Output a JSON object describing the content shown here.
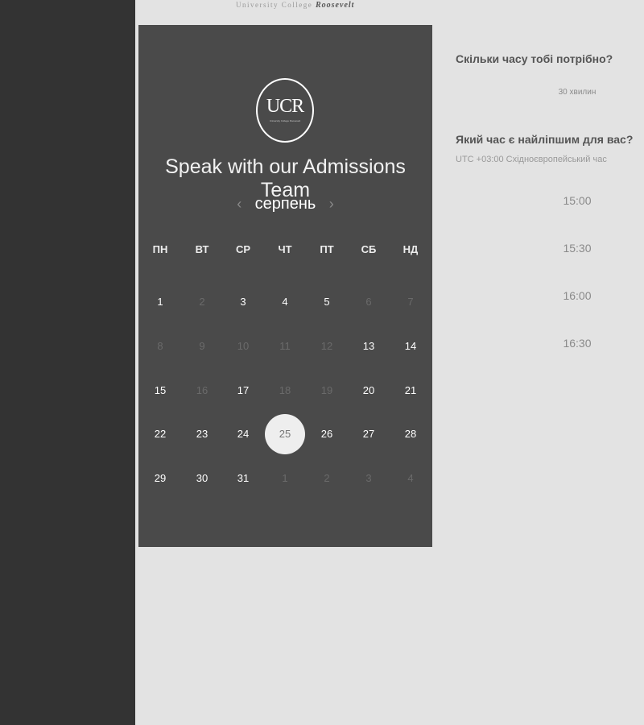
{
  "brand": {
    "prefix": "University College ",
    "name": "Roosevelt"
  },
  "calendar": {
    "logo": {
      "text": "UCR",
      "subtext": "University College Roosevelt"
    },
    "title": "Speak with our Admissions Team",
    "month": "серпень",
    "prev_icon": "‹",
    "next_icon": "›",
    "weekdays": [
      "ПН",
      "ВТ",
      "СР",
      "ЧТ",
      "ПТ",
      "СБ",
      "НД"
    ],
    "weeks": [
      [
        {
          "d": "1",
          "s": "available"
        },
        {
          "d": "2",
          "s": "disabled"
        },
        {
          "d": "3",
          "s": "available"
        },
        {
          "d": "4",
          "s": "available"
        },
        {
          "d": "5",
          "s": "available"
        },
        {
          "d": "6",
          "s": "disabled"
        },
        {
          "d": "7",
          "s": "disabled"
        }
      ],
      [
        {
          "d": "8",
          "s": "disabled"
        },
        {
          "d": "9",
          "s": "disabled"
        },
        {
          "d": "10",
          "s": "disabled"
        },
        {
          "d": "11",
          "s": "disabled"
        },
        {
          "d": "12",
          "s": "disabled"
        },
        {
          "d": "13",
          "s": "available"
        },
        {
          "d": "14",
          "s": "available"
        }
      ],
      [
        {
          "d": "15",
          "s": "available"
        },
        {
          "d": "16",
          "s": "disabled"
        },
        {
          "d": "17",
          "s": "available"
        },
        {
          "d": "18",
          "s": "disabled"
        },
        {
          "d": "19",
          "s": "disabled"
        },
        {
          "d": "20",
          "s": "available"
        },
        {
          "d": "21",
          "s": "available"
        }
      ],
      [
        {
          "d": "22",
          "s": "available"
        },
        {
          "d": "23",
          "s": "available"
        },
        {
          "d": "24",
          "s": "available"
        },
        {
          "d": "25",
          "s": "selected"
        },
        {
          "d": "26",
          "s": "available"
        },
        {
          "d": "27",
          "s": "available"
        },
        {
          "d": "28",
          "s": "available"
        }
      ],
      [
        {
          "d": "29",
          "s": "available"
        },
        {
          "d": "30",
          "s": "available"
        },
        {
          "d": "31",
          "s": "available"
        },
        {
          "d": "1",
          "s": "disabled"
        },
        {
          "d": "2",
          "s": "disabled"
        },
        {
          "d": "3",
          "s": "disabled"
        },
        {
          "d": "4",
          "s": "disabled"
        }
      ]
    ]
  },
  "booking": {
    "duration_question": "Скільки часу тобі потрібно?",
    "duration": "30 хвилин",
    "time_question": "Який час є найліпшим для вас?",
    "timezone": "UTC +03:00 Східноєвропейський час",
    "slots": [
      "15:00",
      "15:30",
      "16:00",
      "16:30"
    ]
  },
  "colors": {
    "sidebar": "#333333",
    "calendar_bg": "#4a4a4a",
    "page_bg": "#e3e3e3",
    "selected_day": "#eeeeee"
  }
}
